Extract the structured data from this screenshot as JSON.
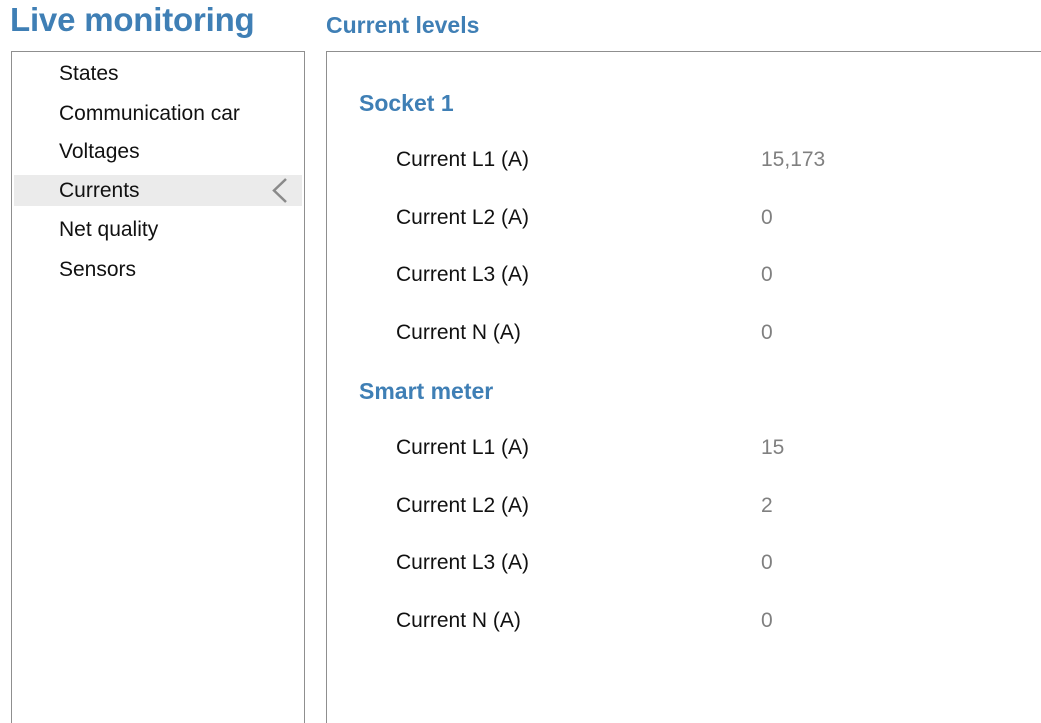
{
  "app_title": "Live monitoring",
  "section_title": "Current levels",
  "sidebar": {
    "items": [
      {
        "label": "States"
      },
      {
        "label": "Communication car"
      },
      {
        "label": "Voltages"
      },
      {
        "label": "Currents",
        "selected": true
      },
      {
        "label": "Net quality"
      },
      {
        "label": "Sensors"
      }
    ]
  },
  "groups": [
    {
      "title": "Socket 1",
      "rows": [
        {
          "label": "Current L1 (A)",
          "value": "15,173"
        },
        {
          "label": "Current L2 (A)",
          "value": "0"
        },
        {
          "label": "Current L3 (A)",
          "value": "0"
        },
        {
          "label": "Current N (A)",
          "value": "0"
        }
      ]
    },
    {
      "title": "Smart meter",
      "rows": [
        {
          "label": "Current L1 (A)",
          "value": "15"
        },
        {
          "label": "Current L2 (A)",
          "value": "2"
        },
        {
          "label": "Current L3 (A)",
          "value": "0"
        },
        {
          "label": "Current N (A)",
          "value": "0"
        }
      ]
    }
  ],
  "colors": {
    "accent": "#3f7fb5",
    "value_text": "#808080",
    "selected_bg": "#ebebeb",
    "border": "#8f8f8f"
  },
  "icons": {
    "selected_indicator": "chevron-left-icon"
  }
}
